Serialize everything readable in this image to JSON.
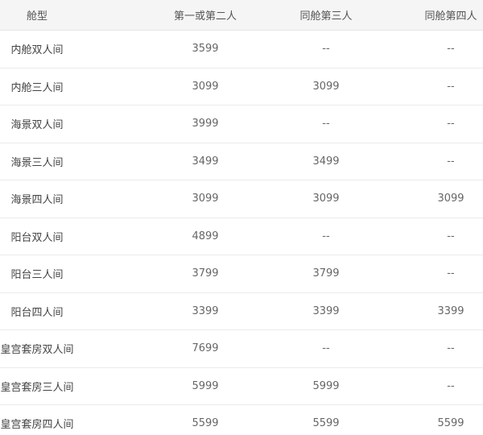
{
  "table": {
    "headers": [
      "舱型",
      "第一或第二人",
      "同舱第三人",
      "同舱第四人"
    ],
    "rows": [
      [
        "内舱双人间",
        "3599",
        "--",
        "--"
      ],
      [
        "内舱三人间",
        "3099",
        "3099",
        "--"
      ],
      [
        "海景双人间",
        "3999",
        "--",
        "--"
      ],
      [
        "海景三人间",
        "3499",
        "3499",
        "--"
      ],
      [
        "海景四人间",
        "3099",
        "3099",
        "3099"
      ],
      [
        "阳台双人间",
        "4899",
        "--",
        "--"
      ],
      [
        "阳台三人间",
        "3799",
        "3799",
        "--"
      ],
      [
        "阳台四人间",
        "3399",
        "3399",
        "3399"
      ],
      [
        "皇宫套房双人间",
        "7699",
        "--",
        "--"
      ],
      [
        "皇宫套房三人间",
        "5999",
        "5999",
        "--"
      ],
      [
        "皇宫套房四人间",
        "5599",
        "5599",
        "5599"
      ]
    ]
  }
}
